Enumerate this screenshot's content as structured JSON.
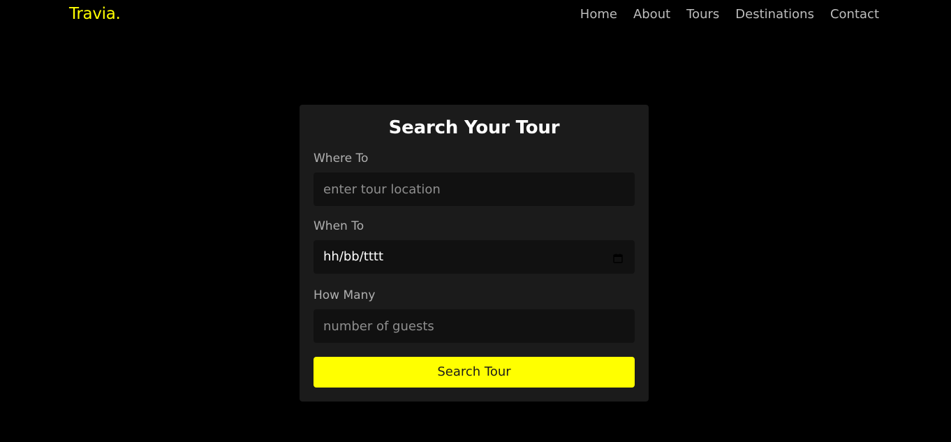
{
  "header": {
    "logo": "Travia.",
    "nav": [
      "Home",
      "About",
      "Tours",
      "Destinations",
      "Contact"
    ]
  },
  "form": {
    "title": "Search Your Tour",
    "where": {
      "label": "Where To",
      "placeholder": "enter tour location",
      "value": ""
    },
    "when": {
      "label": "When To",
      "value": "hh/bb/tttt",
      "icon": "calendar-icon"
    },
    "how_many": {
      "label": "How Many",
      "placeholder": "number of guests",
      "value": ""
    },
    "submit_label": "Search Tour"
  },
  "colors": {
    "accent": "#ffff00",
    "background": "#000000",
    "card": "#1b1b1b",
    "input": "#111111"
  }
}
